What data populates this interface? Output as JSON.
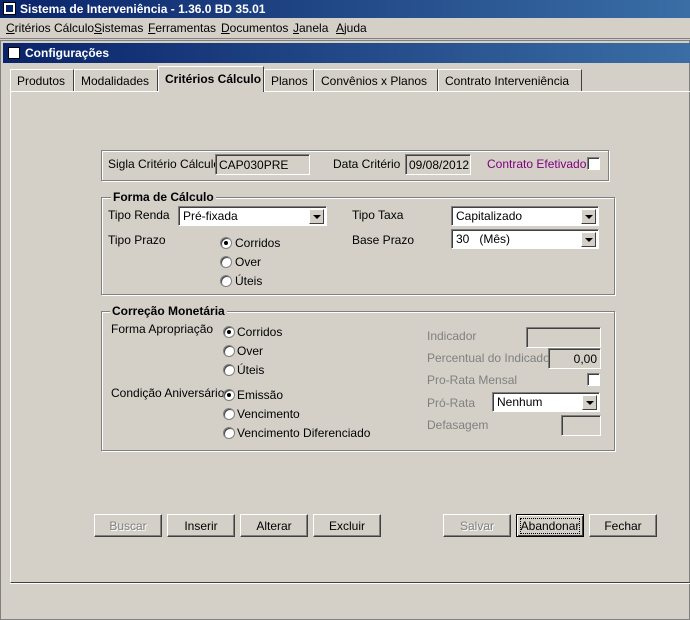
{
  "window": {
    "title": "Sistema de Interveniência - 1.36.0 BD 35.01"
  },
  "menu": [
    "Critérios Cálculo",
    "Sistemas",
    "Ferramentas",
    "Documentos",
    "Janela",
    "Ajuda"
  ],
  "child_window": {
    "title": "Configurações"
  },
  "tabs": [
    "Produtos",
    "Modalidades",
    "Critérios Cálculo",
    "Planos",
    "Convênios x Planos",
    "Contrato Interveniência"
  ],
  "active_tab": "Critérios Cálculo",
  "header": {
    "sigla_label": "Sigla Critério Cálculo",
    "sigla_value": "CAP030PRE",
    "data_label": "Data Critério",
    "data_value": "09/08/2012",
    "contrato_label": "Contrato Efetivado",
    "contrato_checked": false
  },
  "forma_calculo": {
    "title": "Forma de Cálculo",
    "tipo_renda_label": "Tipo Renda",
    "tipo_renda_value": "Pré-fixada",
    "tipo_taxa_label": "Tipo Taxa",
    "tipo_taxa_value": "Capitalizado",
    "tipo_prazo_label": "Tipo Prazo",
    "prazo_options": [
      "Corridos",
      "Over",
      "Úteis"
    ],
    "prazo_selected": "Corridos",
    "base_prazo_label": "Base Prazo",
    "base_prazo_value": "30   (Mês)"
  },
  "correcao": {
    "title": "Correção Monetária",
    "forma_label": "Forma Apropriação",
    "forma_options": [
      "Corridos",
      "Over",
      "Úteis"
    ],
    "forma_selected": "Corridos",
    "condicao_label": "Condição Aniversário",
    "condicao_options": [
      "Emissão",
      "Vencimento",
      "Vencimento Diferenciado"
    ],
    "condicao_selected": "Emissão",
    "indicador_label": "Indicador",
    "indicador_value": "",
    "percentual_label": "Percentual do Indicador",
    "percentual_value": "0,00",
    "prorata_mensal_label": "Pro-Rata Mensal",
    "prorata_label": "Pró-Rata",
    "prorata_value": "Nenhum",
    "defasagem_label": "Defasagem",
    "defasagem_value": ""
  },
  "buttons": {
    "buscar": "Buscar",
    "inserir": "Inserir",
    "alterar": "Alterar",
    "excluir": "Excluir",
    "salvar": "Salvar",
    "abandonar": "Abandonar",
    "fechar": "Fechar"
  }
}
